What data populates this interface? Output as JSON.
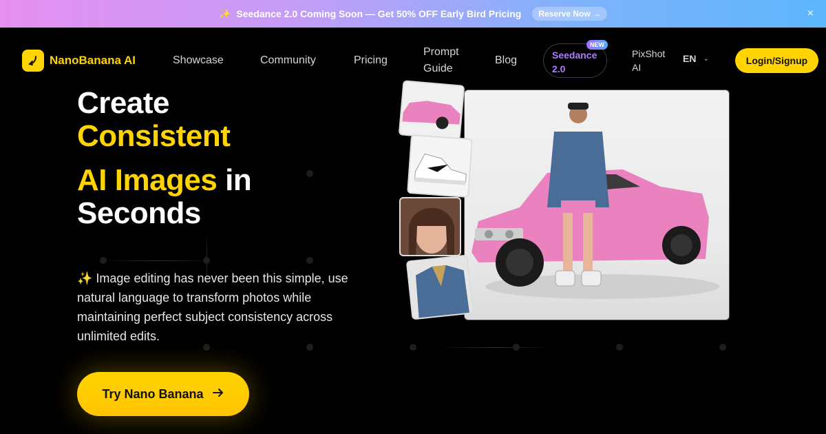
{
  "banner": {
    "text": "Seedance 2.0 Coming Soon — Get 50% OFF Early Bird Pricing",
    "cta": "Reserve Now →",
    "close": "×"
  },
  "nav": {
    "brand": "NanoBanana AI",
    "links": [
      "Showcase",
      "Community",
      "Pricing",
      "Blog"
    ],
    "prompt_guide_line1": "Prompt",
    "prompt_guide_line2": "Guide",
    "seedance_line1": "Seedance",
    "seedance_line2": "2.0",
    "seedance_badge": "NEW",
    "pixshot_line1": "PixShot",
    "pixshot_line2": "AI",
    "language": "EN",
    "login": "Login/Signup"
  },
  "hero": {
    "line1": "Create",
    "line2": "Consistent",
    "line3_highlight": "AI Images",
    "line3_rest": " in",
    "line4": "Seconds",
    "subtext": "✨ Image editing has never been this simple, use natural language to transform photos while maintaining perfect subject consistency across unlimited edits.",
    "cta": "Try Nano Banana"
  },
  "colors": {
    "accent": "#ffd400",
    "seedance": "#b07cff",
    "car": "#ea82bf"
  },
  "icons": {
    "banner": "sparkle-icon",
    "close": "close-icon",
    "logo": "banana-icon",
    "language": "chevron-down-icon",
    "cta": "arrow-right-icon"
  }
}
